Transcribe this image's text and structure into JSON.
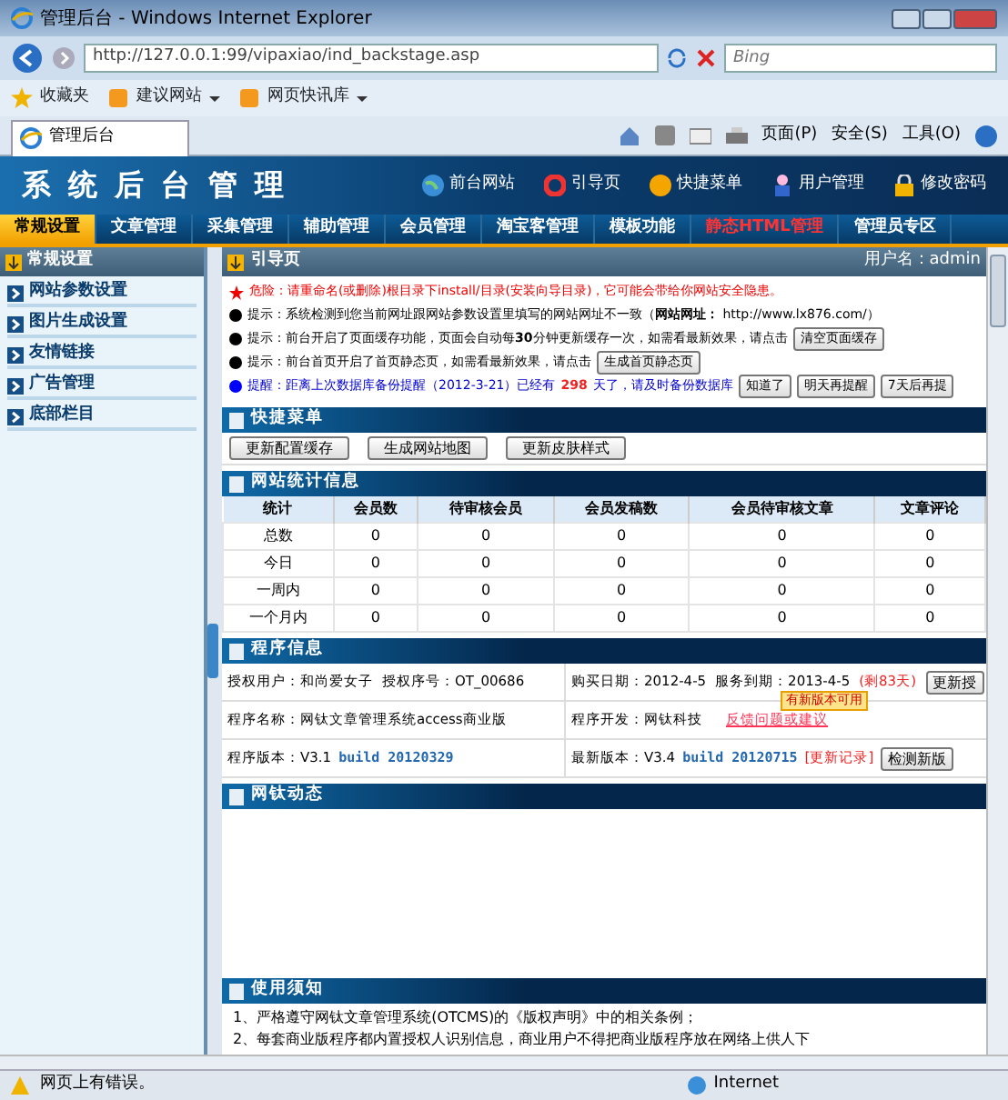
{
  "browser": {
    "title": "管理后台 - Windows Internet Explorer",
    "address": "http://127.0.0.1:99/vipaxiao/ind_backstage.asp",
    "search_placeholder": "Bing",
    "favorites": [
      {
        "label": "收藏夹",
        "kind": "star"
      },
      {
        "label": "建议网站",
        "kind": "menu"
      },
      {
        "label": "网页快讯库",
        "kind": "menu"
      }
    ],
    "tab": "管理后台",
    "commands": [
      "页面(P)",
      "安全(S)",
      "工具(O)"
    ]
  },
  "header": {
    "title": "系 统 后 台 管 理",
    "links": [
      {
        "label": "前台网站",
        "kind": "globe"
      },
      {
        "label": "引导页",
        "kind": "ring"
      },
      {
        "label": "快捷菜单",
        "kind": "ball"
      },
      {
        "label": "用户管理",
        "kind": "user"
      },
      {
        "label": "修改密码",
        "kind": "lock"
      }
    ]
  },
  "nav": [
    {
      "label": "常规设置",
      "selected": true,
      "emphasis": false
    },
    {
      "label": "文章管理",
      "selected": false,
      "emphasis": false
    },
    {
      "label": "采集管理",
      "selected": false,
      "emphasis": false
    },
    {
      "label": "辅助管理",
      "selected": false,
      "emphasis": false
    },
    {
      "label": "会员管理",
      "selected": false,
      "emphasis": false
    },
    {
      "label": "淘宝客管理",
      "selected": false,
      "emphasis": false
    },
    {
      "label": "模板功能",
      "selected": false,
      "emphasis": false
    },
    {
      "label": "静态HTML管理",
      "selected": false,
      "emphasis": true
    },
    {
      "label": "管理员专区",
      "selected": false,
      "emphasis": false
    }
  ],
  "sidebar": {
    "heading": "常规设置",
    "items": [
      "网站参数设置",
      "图片生成设置",
      "友情链接",
      "广告管理",
      "底部栏目"
    ]
  },
  "main": {
    "heading": "引导页",
    "user": "用户名：admin",
    "notices": [
      {
        "kind": "danger",
        "text": "危险：请重命名(或删除)根目录下install/目录(安装向导目录)，它可能会带给你网站安全隐患。"
      },
      {
        "kind": "info",
        "text": "提示：系统检测到您当前网址跟网站参数设置里填写的网站网址不一致（**网站网址：** http://www.lx876.com/）"
      },
      {
        "kind": "info",
        "text": "提示：前台开启了页面缓存功能，页面会自动每**30**分钟更新缓存一次，如需看最新效果，请点击",
        "buttons": [
          "清空页面缓存"
        ]
      },
      {
        "kind": "info",
        "text": "提示：前台首页开启了首页静态页，如需看最新效果，请点击",
        "buttons": [
          "生成首页静态页"
        ]
      },
      {
        "kind": "reminder",
        "text": "提醒：距离上次数据库备份提醒（2012-3-21）已经有",
        "count": "298",
        "text_after": "天了，请及时备份数据库",
        "buttons": [
          "知道了",
          "明天再提醒",
          "7天后再提"
        ]
      }
    ],
    "quick_menu": {
      "heading": "快捷菜单",
      "buttons": [
        "更新配置缓存",
        "生成网站地图",
        "更新皮肤样式"
      ]
    },
    "stats": {
      "heading": "网站统计信息",
      "columns": [
        "统计",
        "会员数",
        "待审核会员",
        "会员发稿数",
        "会员待审核文章",
        "文章评论"
      ],
      "rows": [
        [
          "总数",
          "0",
          "0",
          "0",
          "0",
          "0"
        ],
        [
          "今日",
          "0",
          "0",
          "0",
          "0",
          "0"
        ],
        [
          "一周内",
          "0",
          "0",
          "0",
          "0",
          "0"
        ],
        [
          "一个月内",
          "0",
          "0",
          "0",
          "0",
          "0"
        ]
      ]
    },
    "program": {
      "heading": "程序信息",
      "license_user": "授权用户：和尚爱女子",
      "license_no": "授权序号：OT_00686",
      "purchase": "购买日期：2012-4-5",
      "expiry": "服务到期：2013-4-5",
      "remaining": "(剩83天)",
      "renew_button": "更新授",
      "name": "程序名称：网钛文章管理系统access商业版",
      "developer": "程序开发：网钛科技",
      "feedback": "反馈问题或建议",
      "tooltip": "有新版本可用",
      "version_label": "程序版本：V3.1",
      "version_build": "build 20120329",
      "latest_label": "最新版本：V3.4",
      "latest_build": "build 20120715",
      "changelog": "[更新记录]",
      "check_button": "检测新版"
    },
    "news": {
      "heading": "网钛动态"
    },
    "notes": {
      "heading": "使用须知",
      "lines": [
        "1、严格遵守网钛文章管理系统(OTCMS)的《版权声明》中的相关条例；",
        "2、每套商业版程序都内置授权人识别信息，商业用户不得把商业版程序放在网络上供人下"
      ]
    }
  },
  "status_bar": {
    "message": "网页上有错误。",
    "zone": "Internet"
  }
}
